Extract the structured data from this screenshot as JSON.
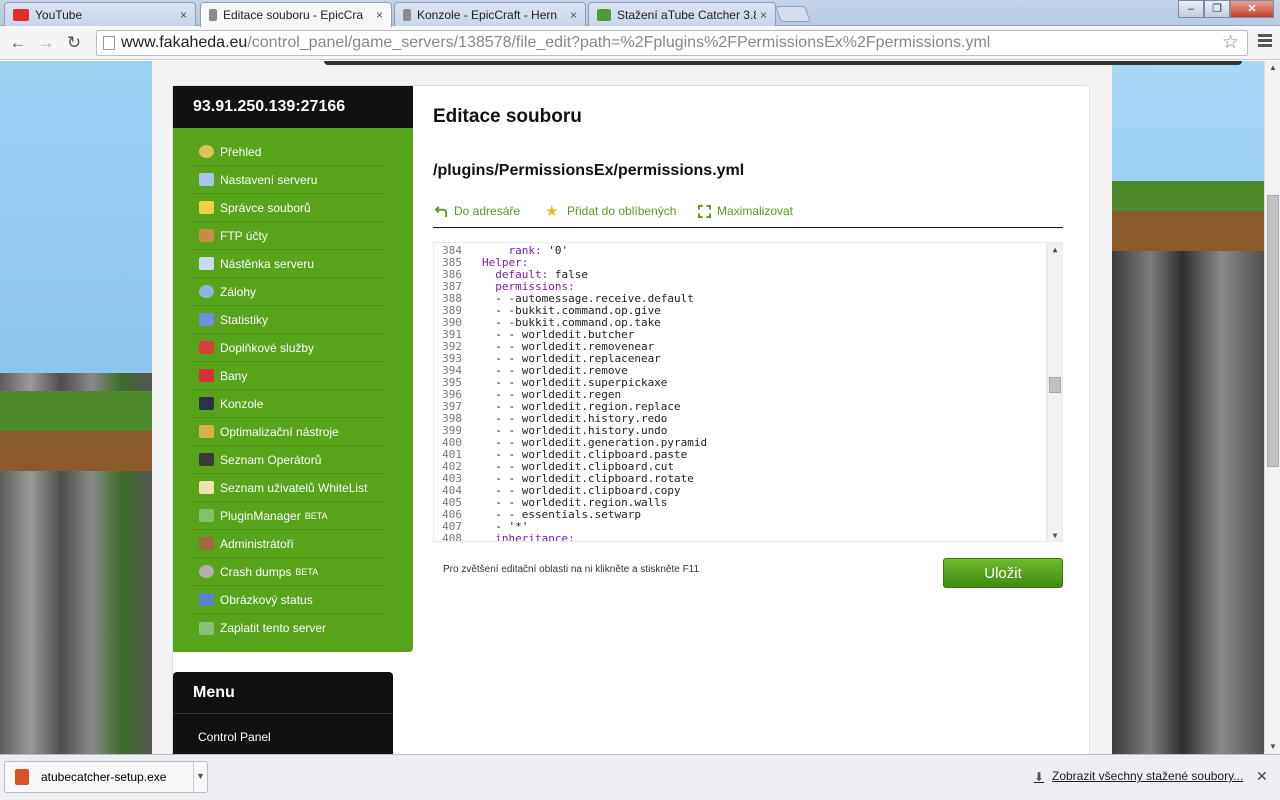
{
  "browser": {
    "tabs": [
      {
        "label": "YouTube",
        "color": "#e52d27"
      },
      {
        "label": "Editace souboru - EpicCra",
        "color": "#8a8a8a"
      },
      {
        "label": "Konzole - EpicCraft - Hern",
        "color": "#8a8a8a"
      },
      {
        "label": "Stažení aTube Catcher 3.8",
        "color": "#4d9a35"
      }
    ],
    "close_glyph": "×",
    "url_host": "www.fakaheda.eu",
    "url_path": "/control_panel/game_servers/138578/file_edit?path=%2Fplugins%2FPermissionsEx%2Fpermissions.yml"
  },
  "sidebar": {
    "server_address": "93.91.250.139:27166",
    "items": [
      {
        "label": "Přehled",
        "icon": "magnifier-icon",
        "color": "#e0c25a"
      },
      {
        "label": "Nastavení serveru",
        "icon": "wrench-icon",
        "color": "#a9c6e8"
      },
      {
        "label": "Správce souborů",
        "icon": "folder-icon",
        "color": "#f1cf4d"
      },
      {
        "label": "FTP účty",
        "icon": "user-ftp-icon",
        "color": "#c98b45"
      },
      {
        "label": "Nástěnka serveru",
        "icon": "board-icon",
        "color": "#c9d9ee"
      },
      {
        "label": "Zálohy",
        "icon": "disc-icon",
        "color": "#8fb5de"
      },
      {
        "label": "Statistiky",
        "icon": "chart-icon",
        "color": "#6f8fd8"
      },
      {
        "label": "Doplňkové služby",
        "icon": "gift-icon",
        "color": "#d8403a"
      },
      {
        "label": "Bany",
        "icon": "cross-icon",
        "color": "#d8303a"
      },
      {
        "label": "Konzole",
        "icon": "terminal-icon",
        "color": "#2b3440"
      },
      {
        "label": "Optimalizační nástroje",
        "icon": "wand-icon",
        "color": "#d9b04a"
      },
      {
        "label": "Seznam Operátorů",
        "icon": "operator-icon",
        "color": "#3a3a3a"
      },
      {
        "label": "Seznam uživatelů WhiteList",
        "icon": "clipboard-icon",
        "color": "#efe3b0"
      },
      {
        "label": "PluginManager",
        "badge": "BETA",
        "icon": "puzzle-icon",
        "color": "#86c06a"
      },
      {
        "label": "Administrátoři",
        "icon": "admin-icon",
        "color": "#a06a3a"
      },
      {
        "label": "Crash dumps",
        "badge": "BETA",
        "icon": "gear-icon",
        "color": "#b0b0b0"
      },
      {
        "label": "Obrázkový status",
        "icon": "image-icon",
        "color": "#5a84c8"
      },
      {
        "label": "Zaplatit tento server",
        "icon": "money-icon",
        "color": "#8ac07a"
      }
    ]
  },
  "menu": {
    "title": "Menu",
    "items": [
      "Control Panel"
    ]
  },
  "content": {
    "title": "Editace souboru",
    "file_path": "/plugins/PermissionsEx/permissions.yml",
    "actions": [
      {
        "label": "Do adresáře",
        "icon": "back-arrow-icon",
        "color": "#5a9a1e"
      },
      {
        "label": "Přidat do oblíbených",
        "icon": "star-icon",
        "color": "#f0b429"
      },
      {
        "label": "Maximalizovat",
        "icon": "maximize-icon",
        "color": "#5a9a1e"
      }
    ],
    "line_numbers": [
      "384",
      "385",
      "386",
      "387",
      "388",
      "389",
      "390",
      "391",
      "392",
      "393",
      "394",
      "395",
      "396",
      "397",
      "398",
      "399",
      "400",
      "401",
      "402",
      "403",
      "404",
      "405",
      "406",
      "407",
      "408"
    ],
    "code_lines": [
      "    rank: '0'",
      "Helper:",
      "  default: false",
      "  permissions:",
      "  - -automessage.receive.default",
      "  - -bukkit.command.op.give",
      "  - -bukkit.command.op.take",
      "  - - worldedit.butcher",
      "  - - worldedit.removenear",
      "  - - worldedit.replacenear",
      "  - - worldedit.remove",
      "  - - worldedit.superpickaxe",
      "  - - worldedit.regen",
      "  - - worldedit.region.replace",
      "  - - worldedit.history.redo",
      "  - - worldedit.history.undo",
      "  - - worldedit.generation.pyramid",
      "  - - worldedit.clipboard.paste",
      "  - - worldedit.clipboard.cut",
      "  - - worldedit.clipboard.rotate",
      "  - - worldedit.clipboard.copy",
      "  - - worldedit.region.walls",
      "  - - essentials.setwarp",
      "  - '*'",
      "  inheritance:"
    ],
    "hint": "Pro zvětšení editační oblasti na ni klikněte a stiskněte F11",
    "save_label": "Uložit"
  },
  "downloads": {
    "file": "atubecatcher-setup.exe",
    "show_all": "Zobrazit všechny stažené soubory..."
  }
}
